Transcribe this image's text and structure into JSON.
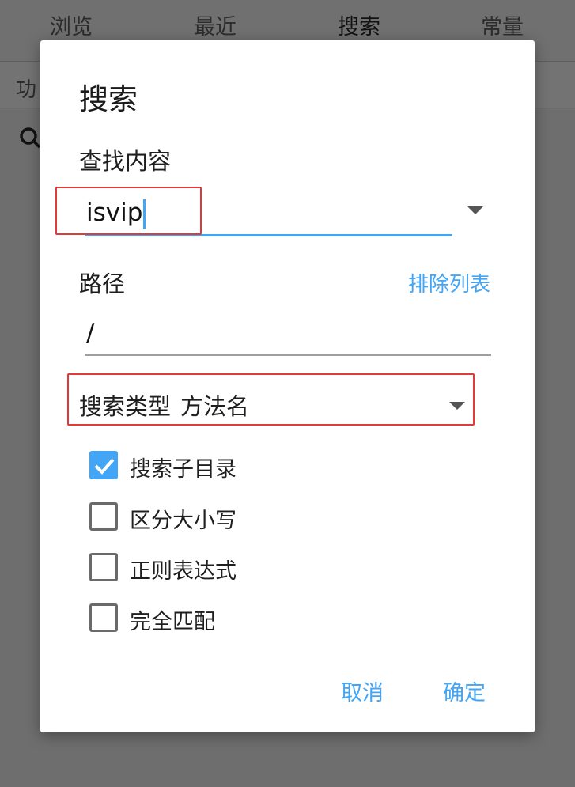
{
  "background": {
    "tabs": [
      "浏览",
      "最近",
      "搜索",
      "常量"
    ],
    "active_tab": "搜索",
    "subbar_label": "功"
  },
  "dialog": {
    "title": "搜索",
    "find_label": "查找内容",
    "find_value": "isvip",
    "path_label": "路径",
    "exclude_list_link": "排除列表",
    "path_value": "/",
    "search_type_label": "搜索类型",
    "search_type_value": "方法名",
    "options": [
      {
        "label": "搜索子目录",
        "checked": true
      },
      {
        "label": "区分大小写",
        "checked": false
      },
      {
        "label": "正则表达式",
        "checked": false
      },
      {
        "label": "完全匹配",
        "checked": false
      }
    ],
    "cancel_label": "取消",
    "ok_label": "确定"
  },
  "colors": {
    "accent": "#42a5f5",
    "highlight_border": "#e53935",
    "overlay": "#6e6e6e"
  }
}
